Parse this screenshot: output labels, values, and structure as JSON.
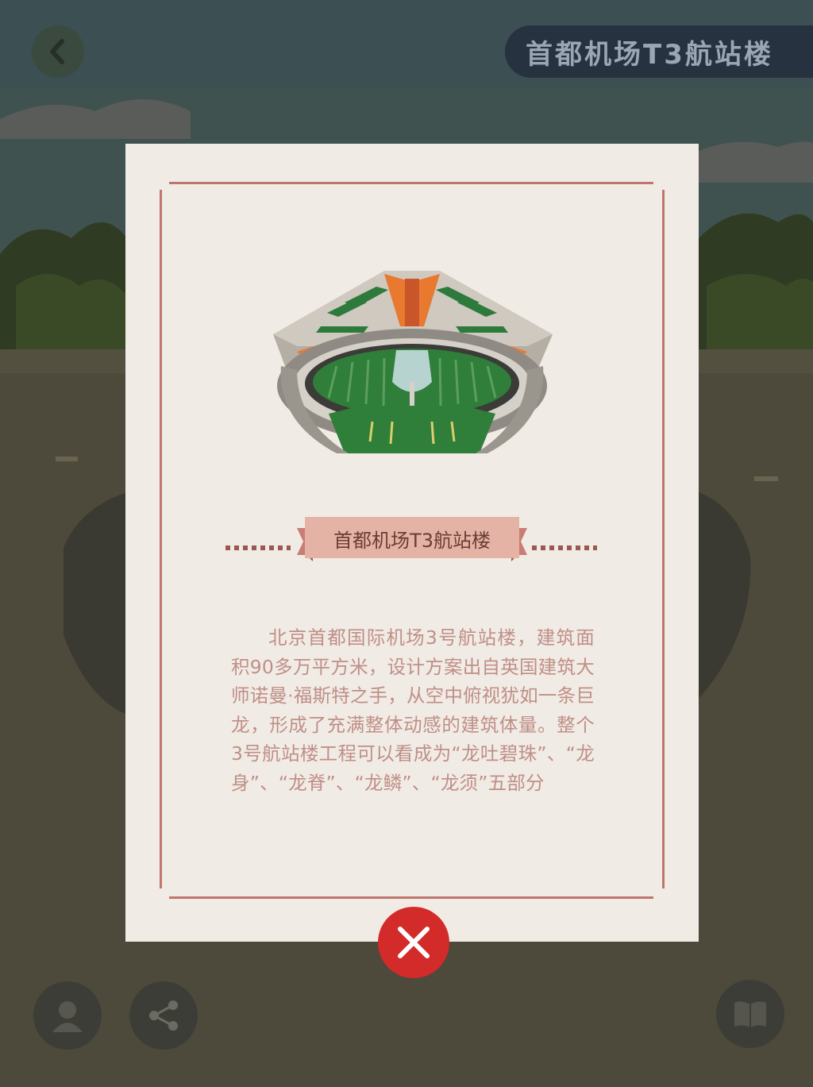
{
  "header": {
    "title": "首都机场T3航站楼"
  },
  "modal": {
    "heading": "首都机场T3航站楼",
    "description": "北京首都国际机场3号航站楼，建筑面积90多万平方米，设计方案出自英国建筑大师诺曼·福斯特之手，从空中俯视犹如一条巨龙，形成了充满整体动感的建筑体量。整个3号航站楼工程可以看成为“龙吐碧珠”、“龙身”、“龙脊”、“龙鳞”、“龙须”五部分"
  },
  "colors": {
    "card_bg": "#f1ebe5",
    "frame": "#c0756e",
    "ribbon": "#e5b3a6",
    "text": "#bf8f87",
    "close": "#d32a2a"
  },
  "icons": [
    "back-icon",
    "avatar-icon",
    "share-icon",
    "book-icon",
    "close-icon"
  ]
}
